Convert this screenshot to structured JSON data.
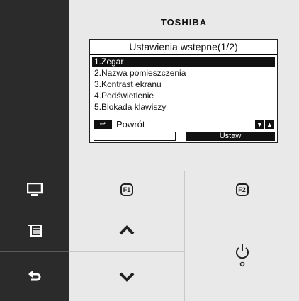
{
  "brand": "TOSHIBA",
  "screen": {
    "title": "Ustawienia wstępne(1/2)",
    "items": [
      {
        "label": "1.Zegar",
        "selected": true
      },
      {
        "label": "2.Nazwa pomieszczenia",
        "selected": false
      },
      {
        "label": "3.Kontrast ekranu",
        "selected": false
      },
      {
        "label": "4.Podświetlenie",
        "selected": false
      },
      {
        "label": "5.Blokada klawiszy",
        "selected": false
      }
    ],
    "back_label": "Powrót",
    "set_label": "Ustaw"
  },
  "keys": {
    "f1": "F1",
    "f2": "F2"
  },
  "icons": {
    "display": "monitor-icon",
    "menu": "menu-list-icon",
    "back": "back-arrow-icon",
    "up": "chevron-up-icon",
    "down": "chevron-down-icon",
    "power": "power-icon"
  }
}
